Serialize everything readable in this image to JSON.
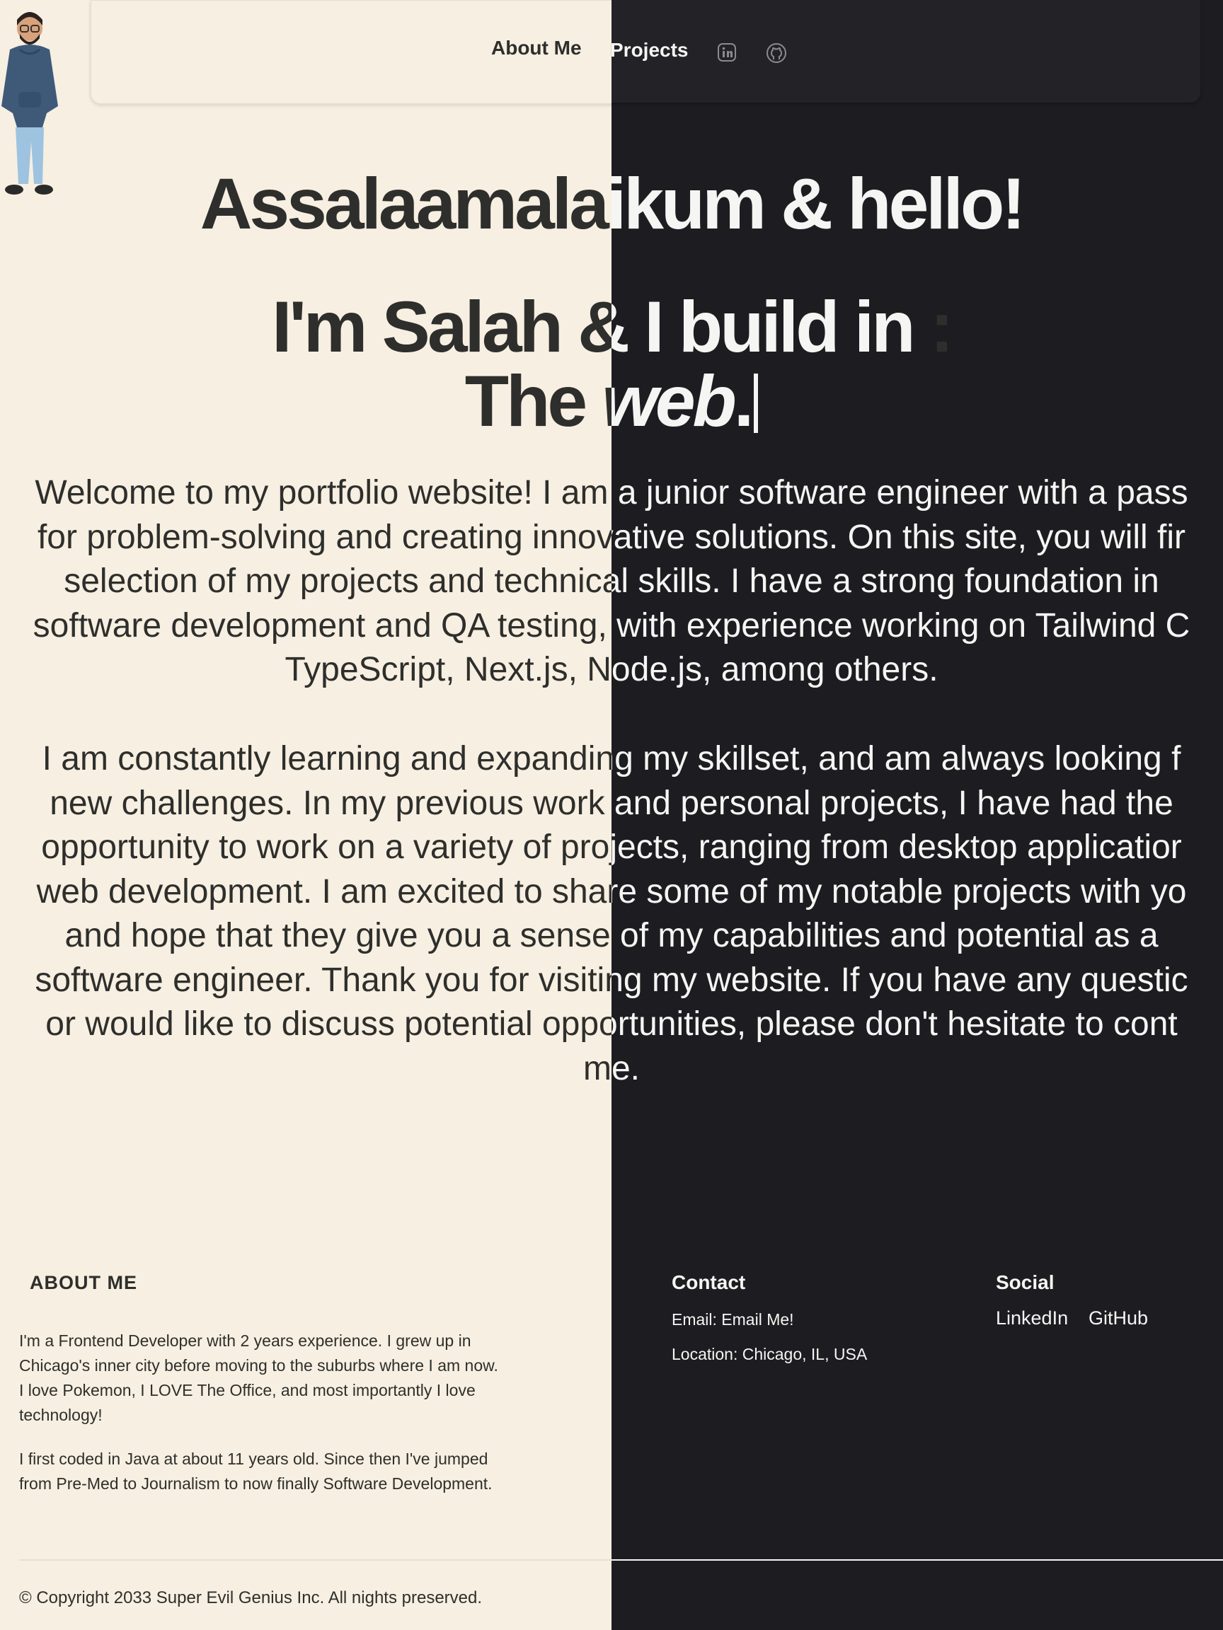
{
  "nav": {
    "about_label": "About Me",
    "projects_label": "Projects",
    "linkedin_icon": "linkedin-icon",
    "github_icon": "github-icon"
  },
  "hero": {
    "greeting": "Assalaamalaikum & hello!",
    "line1": "I'm Salah & I build in",
    "line1_colon": ":",
    "line2_prefix": "The ",
    "line2_em": "web",
    "line2_suffix": "."
  },
  "intro": {
    "paragraph1_lines": [
      "Welcome to my portfolio website! I am a junior software engineer with a pass",
      "for problem-solving and creating innovative solutions. On this site, you will fir",
      "selection of my projects and technical skills. I have a strong foundation in",
      "software development and QA testing, with experience working on Tailwind C",
      "TypeScript, Next.js, Node.js, among others."
    ],
    "paragraph2_lines": [
      "I am constantly learning and expanding my skillset, and am always looking f",
      "new challenges. In my previous work and personal projects, I have had the",
      "opportunity to work on a variety of projects, ranging from desktop applicatior",
      "web development. I am excited to share some of my notable projects with yo",
      "and hope that they give you a sense of my capabilities and potential as a",
      "software engineer. Thank you for visiting my website. If you have any questic",
      "or would like to discuss potential opportunities, please don't hesitate to cont",
      "me."
    ]
  },
  "footer": {
    "about_title": "ABOUT ME",
    "about_p1": "I'm a Frontend Developer with 2 years experience. I grew up in Chicago's inner city before moving to the suburbs where I am now. I love Pokemon, I LOVE The Office, and most importantly I love technology!",
    "about_p2": "I first coded in Java at about 11 years old. Since then I've jumped from Pre-Med to Journalism to now finally Software Development.",
    "contact_title": "Contact",
    "email": "Email: Email Me!",
    "location": "Location: Chicago, IL, USA",
    "social_title": "Social",
    "linkedin": "LinkedIn",
    "github": "GitHub",
    "copyright": "© Copyright 2033 Super Evil Genius Inc. All nights preserved."
  },
  "colors": {
    "light_bg": "#f7efe1",
    "dark_bg": "#1d1d21",
    "light_text": "#2e2f2c",
    "dark_text": "#f5f5f3"
  }
}
